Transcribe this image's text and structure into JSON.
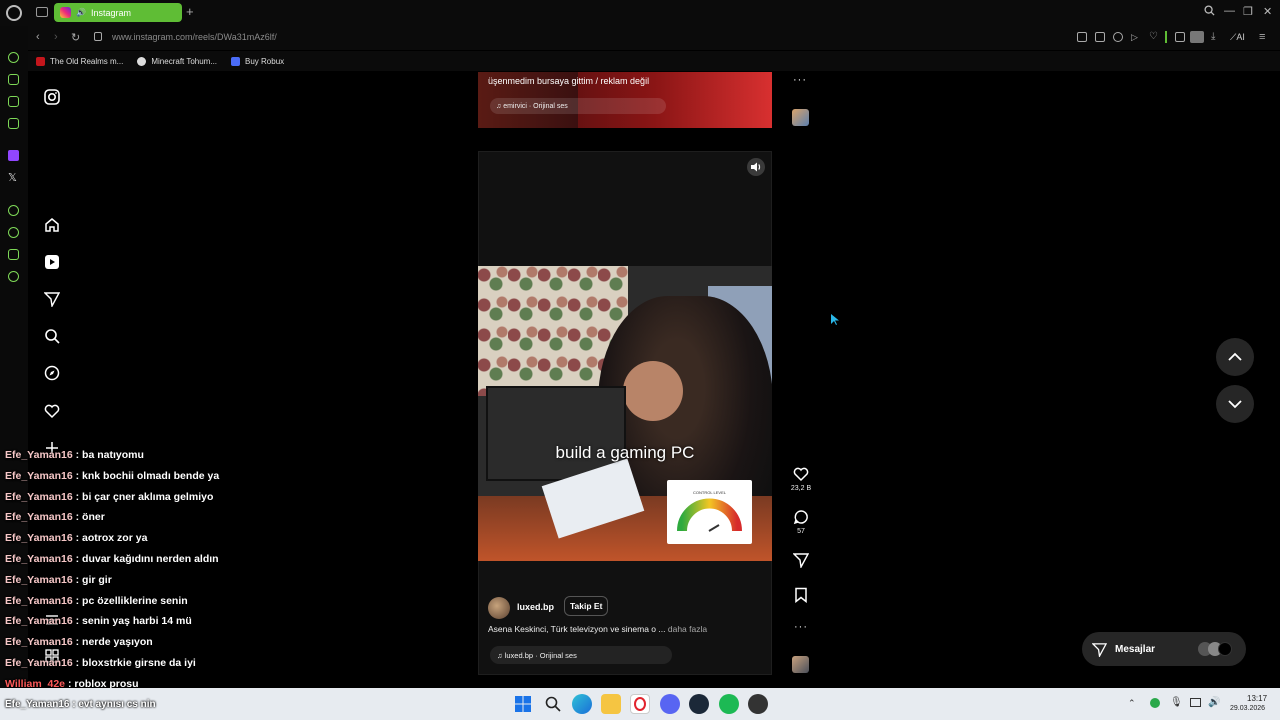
{
  "browser": {
    "tab_title": "Instagram",
    "url": "www.instagram.com/reels/DWa31mAz6lf/",
    "ai_label": "AI",
    "bookmarks": [
      {
        "label": "The Old Realms m...",
        "color": "#c4161c"
      },
      {
        "label": "Minecraft Tohum...",
        "color": "#dddddd"
      },
      {
        "label": "Buy Robux",
        "color": "#4a6cf7"
      }
    ]
  },
  "prev_reel": {
    "caption": "üşenmedim bursaya gittim / reklam değil",
    "audio": "emirvici · Orijinal ses"
  },
  "reel": {
    "overlay_text": "build a gaming PC",
    "author": "luxed.bp",
    "follow_label": "Takip Et",
    "description": "Asena Keskinci, Türk televizyon ve sinema o ...",
    "more_label": "daha fazla",
    "audio": "luxed.bp · Orijinal ses",
    "likes": "23,2 B",
    "comments": "57",
    "meter_label": "CONTROL LEVEL"
  },
  "messages": {
    "label": "Mesajlar"
  },
  "chat": [
    {
      "user": "Efe_Yaman16",
      "text": " : ba natıyomu"
    },
    {
      "user": "Efe_Yaman16",
      "text": " : knk bochii olmadı bende ya"
    },
    {
      "user": "Efe_Yaman16",
      "text": " : bi çar çner aklıma gelmiyo"
    },
    {
      "user": "Efe_Yaman16",
      "text": " : öner"
    },
    {
      "user": "Efe_Yaman16",
      "text": " : aotrox zor ya"
    },
    {
      "user": "Efe_Yaman16",
      "text": " : duvar kağıdını nerden aldın"
    },
    {
      "user": "Efe_Yaman16",
      "text": " : gir gir"
    },
    {
      "user": "Efe_Yaman16",
      "text": " : pc özelliklerine senin"
    },
    {
      "user": "Efe_Yaman16",
      "text": " : senin yaş harbi 14 mü"
    },
    {
      "user": "Efe_Yaman16",
      "text": " : nerde yaşıyon"
    },
    {
      "user": "Efe_Yaman16",
      "text": " : bloxstrkie girsne da iyi"
    },
    {
      "user": "William_42e",
      "text": " : roblox prosu"
    }
  ],
  "taskbar": {
    "chat_line": "Efe_Yaman16 : evt aynısı cs nin",
    "time": "13:17",
    "date": "29.03.2026"
  }
}
